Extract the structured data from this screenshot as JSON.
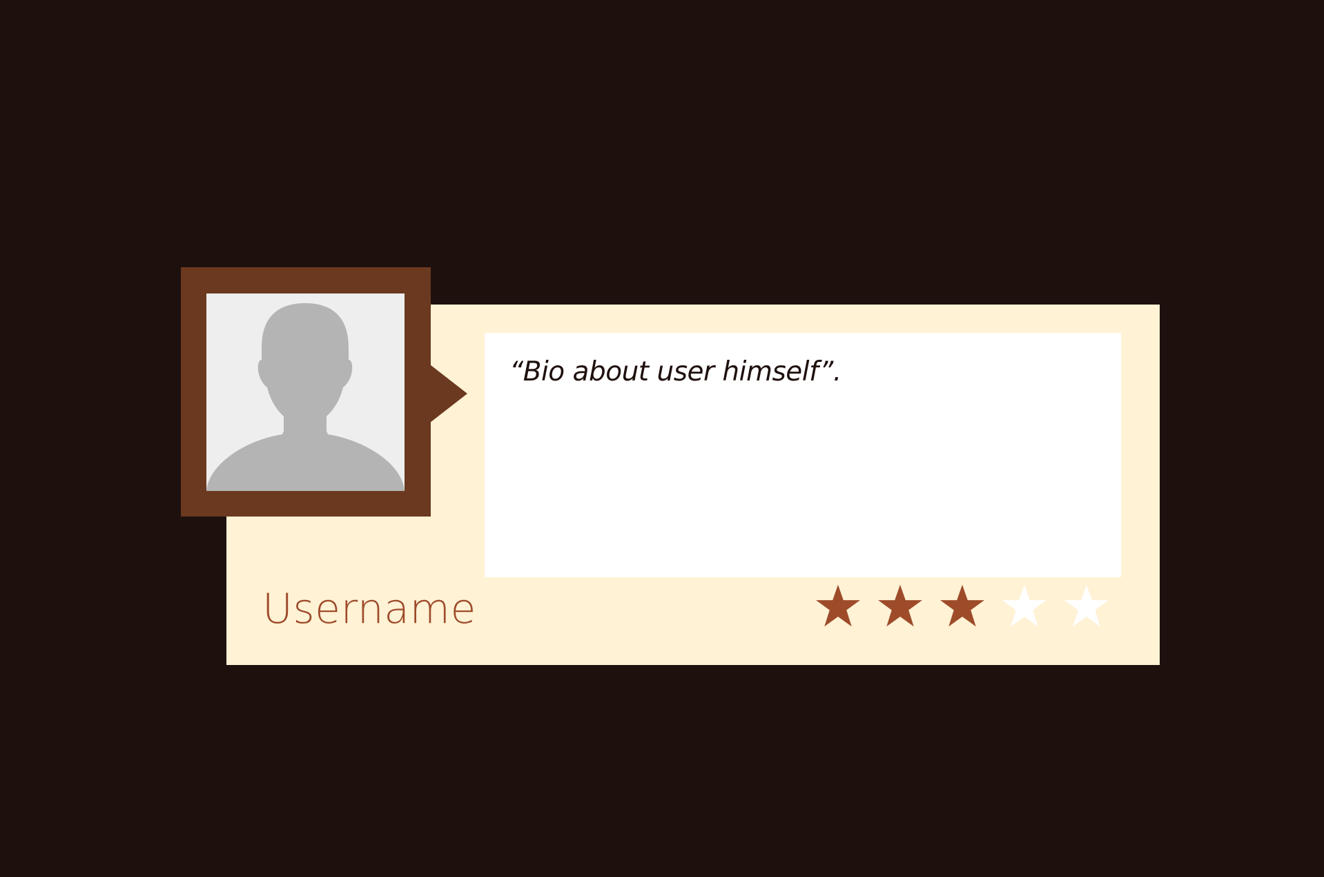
{
  "profile": {
    "bio": "“Bio about user himself”.",
    "username": "Username",
    "avatar_icon": "user-silhouette-icon",
    "rating": {
      "value": 3,
      "max": 5,
      "filled_color": "#9e4b2a",
      "empty_color": "#ffffff",
      "icon": "star-icon"
    }
  },
  "colors": {
    "background": "#1e100d",
    "card": "#fff2d5",
    "frame": "#6b391f",
    "accent": "#9e4b2a"
  }
}
